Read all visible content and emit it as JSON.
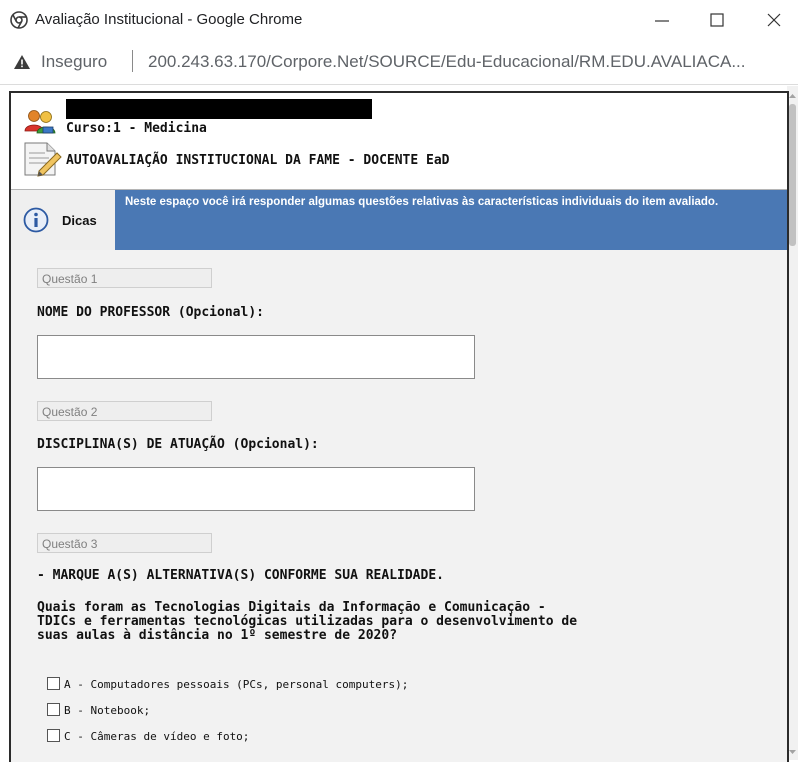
{
  "window": {
    "title": "Avaliação Institucional - Google Chrome",
    "security_label": "Inseguro",
    "url": "200.243.63.170/Corpore.Net/SOURCE/Edu-Educacional/RM.EDU.AVALIACA..."
  },
  "header": {
    "course": "Curso:1 - Medicina",
    "form_title": "AUTOAVALIAÇÃO INSTITUCIONAL DA FAME - DOCENTE EaD"
  },
  "tips": {
    "label": "Dicas",
    "text": "Neste espaço você irá responder algumas questões relativas às características individuais do item avaliado."
  },
  "questions": [
    {
      "tag": "Questão 1",
      "title": "NOME DO PROFESSOR (Opcional):",
      "value": ""
    },
    {
      "tag": "Questão 2",
      "title": "DISCIPLINA(S) DE ATUAÇÃO (Opcional):",
      "value": ""
    },
    {
      "tag": "Questão 3",
      "title": "- MARQUE A(S) ALTERNATIVA(S) CONFORME SUA REALIDADE.",
      "text_lines": [
        "Quais foram as Tecnologias Digitais da Informação e Comunicação -",
        "TDICs e ferramentas tecnológicas utilizadas para o desenvolvimento de",
        "suas aulas à distância no 1º semestre de 2020?"
      ],
      "options": [
        {
          "label": "A - Computadores pessoais (PCs, personal computers);",
          "checked": false
        },
        {
          "label": "B - Notebook;",
          "checked": false
        },
        {
          "label": "C - Câmeras de vídeo e foto;",
          "checked": false
        }
      ]
    }
  ],
  "colors": {
    "tips_bg": "#4a78b4",
    "content_bg": "#f2f2f2"
  }
}
